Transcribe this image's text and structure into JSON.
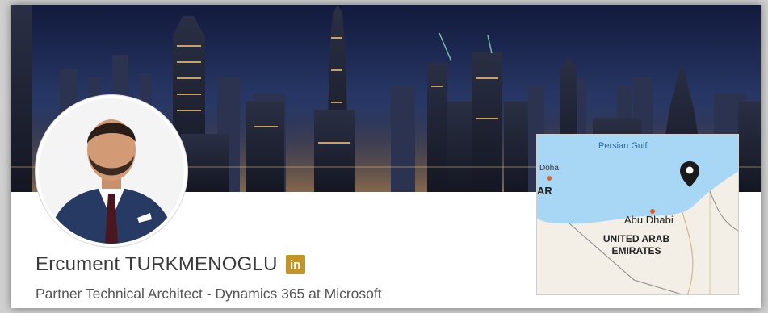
{
  "profile": {
    "name": "Ercument TURKMENOGLU",
    "headline": "Partner Technical Architect - Dynamics 365 at Microsoft",
    "linkedin_badge": "in"
  },
  "banner": {
    "image": "city-skyline-night",
    "avatar": "profile-photo"
  },
  "map": {
    "water_label": "Persian Gulf",
    "city_left": "Doha",
    "country_fragment": "AR",
    "city": "Abu Dhabi",
    "country_line1": "UNITED ARAB",
    "country_line2": "EMIRATES",
    "pin_icon": "location-pin-icon"
  },
  "colors": {
    "badge": "#c39528",
    "water": "#a8d6f5",
    "land": "#f3efe6",
    "name_text": "#3a3a3a",
    "headline_text": "#555555"
  }
}
